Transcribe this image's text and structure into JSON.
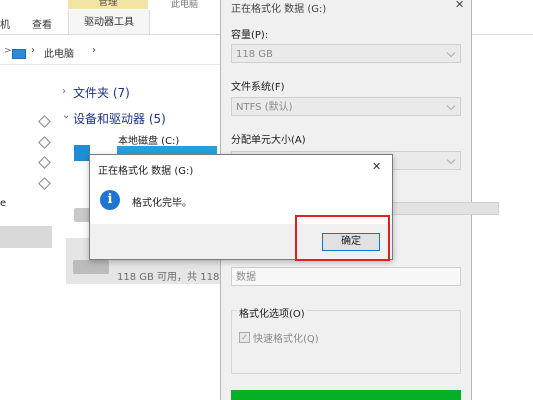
{
  "ribbon": {
    "tabs": [
      "机",
      "查看"
    ],
    "manage_tab": "管理",
    "tools_tab": "驱动器工具",
    "context_label": "此电脑"
  },
  "address": {
    "location": "此电脑"
  },
  "explorer": {
    "folders_group": "文件夹 (7)",
    "devices_group": "设备和驱动器 (5)",
    "drive_c": "本地磁盘 (C:)",
    "drive_g_info": "118 GB 可用，共 118",
    "side_char": "e"
  },
  "format_panel": {
    "title": "正在格式化 数据 (G:)",
    "capacity_label": "容量(P):",
    "capacity_value": "118 GB",
    "filesystem_label": "文件系统(F)",
    "filesystem_value": "NTFS (默认)",
    "alloc_label": "分配单元大小(A)",
    "volume_value": "数据",
    "options_label": "格式化选项(O)",
    "quick_format": "快速格式化(Q)"
  },
  "dialog": {
    "title": "正在格式化 数据 (G:)",
    "message": "格式化完毕。",
    "ok_label": "确定",
    "close_glyph": "✕",
    "info_glyph": "i"
  },
  "colors": {
    "accent": "#0078d7",
    "highlight": "#e0201e",
    "progress": "#06b025",
    "info": "#1f74d1"
  }
}
